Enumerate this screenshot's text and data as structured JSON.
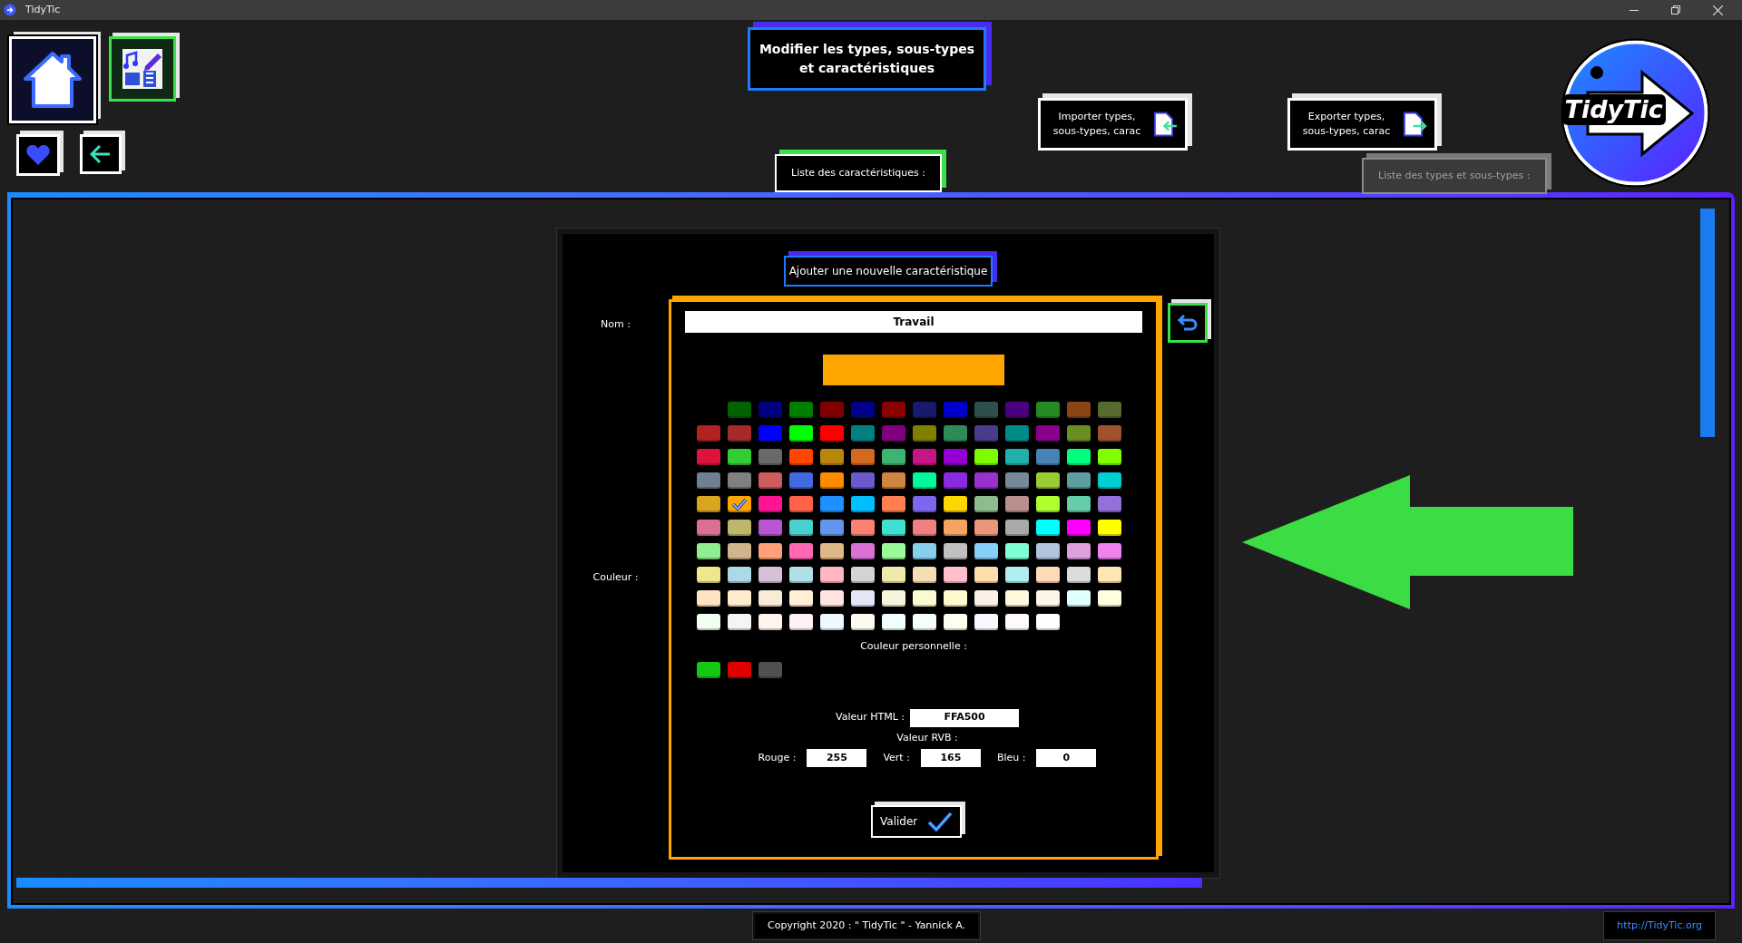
{
  "window": {
    "title": "TidyTic"
  },
  "header": {
    "title": "Modifier les types, sous-types et caractéristiques",
    "import_button": "Importer types, sous-types, carac",
    "export_button": "Exporter types, sous-types, carac",
    "logo_text": "TidyTic"
  },
  "tabs": [
    {
      "label": "Liste des caractéristiques :",
      "selected": true
    },
    {
      "label": "Liste des types et sous-types :",
      "selected": false
    }
  ],
  "form": {
    "add_button": "Ajouter une nouvelle caractéristique",
    "name_label": "Nom :",
    "name_value": "Travail",
    "color_label": "Couleur :",
    "preview": {
      "color": "#ffa500"
    },
    "palette": [
      {
        "color": "#006400",
        "selected": false
      },
      {
        "color": "#000080",
        "selected": false
      },
      {
        "color": "#008000",
        "selected": false
      },
      {
        "color": "#800000",
        "selected": false
      },
      {
        "color": "#00008b",
        "selected": false
      },
      {
        "color": "#8b0000",
        "selected": false
      },
      {
        "color": "#191970",
        "selected": false
      },
      {
        "color": "#0000cd",
        "selected": false
      },
      {
        "color": "#2f4f4f",
        "selected": false
      },
      {
        "color": "#4b0082",
        "selected": false
      },
      {
        "color": "#228b22",
        "selected": false
      },
      {
        "color": "#8b4513",
        "selected": false
      },
      {
        "color": "#556b2f",
        "selected": false
      },
      {
        "color": "#b22222",
        "selected": false
      },
      {
        "color": "#a52a2a",
        "selected": false
      },
      {
        "color": "#0000ff",
        "selected": false
      },
      {
        "color": "#00ff00",
        "selected": false
      },
      {
        "color": "#ff0000",
        "selected": false
      },
      {
        "color": "#008080",
        "selected": false
      },
      {
        "color": "#800080",
        "selected": false
      },
      {
        "color": "#808000",
        "selected": false
      },
      {
        "color": "#2e8b57",
        "selected": false
      },
      {
        "color": "#483d8b",
        "selected": false
      },
      {
        "color": "#008b8b",
        "selected": false
      },
      {
        "color": "#8b008b",
        "selected": false
      },
      {
        "color": "#6b8e23",
        "selected": false
      },
      {
        "color": "#a0522d",
        "selected": false
      },
      {
        "color": "#dc143c",
        "selected": false
      },
      {
        "color": "#32cd32",
        "selected": false
      },
      {
        "color": "#696969",
        "selected": false
      },
      {
        "color": "#ff4500",
        "selected": false
      },
      {
        "color": "#b8860b",
        "selected": false
      },
      {
        "color": "#d2691e",
        "selected": false
      },
      {
        "color": "#3cb371",
        "selected": false
      },
      {
        "color": "#c71585",
        "selected": false
      },
      {
        "color": "#9400d3",
        "selected": false
      },
      {
        "color": "#7cfc00",
        "selected": false
      },
      {
        "color": "#20b2aa",
        "selected": false
      },
      {
        "color": "#4682b4",
        "selected": false
      },
      {
        "color": "#00ff7f",
        "selected": false
      },
      {
        "color": "#7fff00",
        "selected": false
      },
      {
        "color": "#708090",
        "selected": false
      },
      {
        "color": "#808080",
        "selected": false
      },
      {
        "color": "#cd5c5c",
        "selected": false
      },
      {
        "color": "#4169e1",
        "selected": false
      },
      {
        "color": "#ff8c00",
        "selected": false
      },
      {
        "color": "#6a5acd",
        "selected": false
      },
      {
        "color": "#cd853f",
        "selected": false
      },
      {
        "color": "#00fa9a",
        "selected": false
      },
      {
        "color": "#8a2be2",
        "selected": false
      },
      {
        "color": "#9932cc",
        "selected": false
      },
      {
        "color": "#778899",
        "selected": false
      },
      {
        "color": "#9acd32",
        "selected": false
      },
      {
        "color": "#5f9ea0",
        "selected": false
      },
      {
        "color": "#00ced1",
        "selected": false
      },
      {
        "color": "#daa520",
        "selected": false
      },
      {
        "color": "#ffa500",
        "selected": true
      },
      {
        "color": "#ff1493",
        "selected": false
      },
      {
        "color": "#ff6347",
        "selected": false
      },
      {
        "color": "#1e90ff",
        "selected": false
      },
      {
        "color": "#00bfff",
        "selected": false
      },
      {
        "color": "#ff7f50",
        "selected": false
      },
      {
        "color": "#7b68ee",
        "selected": false
      },
      {
        "color": "#ffd700",
        "selected": false
      },
      {
        "color": "#8fbc8f",
        "selected": false
      },
      {
        "color": "#bc8f8f",
        "selected": false
      },
      {
        "color": "#adff2f",
        "selected": false
      },
      {
        "color": "#66cdaa",
        "selected": false
      },
      {
        "color": "#9370db",
        "selected": false
      },
      {
        "color": "#db7093",
        "selected": false
      },
      {
        "color": "#bdb76b",
        "selected": false
      },
      {
        "color": "#ba55d3",
        "selected": false
      },
      {
        "color": "#48d1cc",
        "selected": false
      },
      {
        "color": "#6495ed",
        "selected": false
      },
      {
        "color": "#fa8072",
        "selected": false
      },
      {
        "color": "#40e0d0",
        "selected": false
      },
      {
        "color": "#f08080",
        "selected": false
      },
      {
        "color": "#f4a460",
        "selected": false
      },
      {
        "color": "#e9967a",
        "selected": false
      },
      {
        "color": "#a9a9a9",
        "selected": false
      },
      {
        "color": "#00ffff",
        "selected": false
      },
      {
        "color": "#ff00ff",
        "selected": false
      },
      {
        "color": "#ffff00",
        "selected": false
      },
      {
        "color": "#90ee90",
        "selected": false
      },
      {
        "color": "#d2b48c",
        "selected": false
      },
      {
        "color": "#ffa07a",
        "selected": false
      },
      {
        "color": "#ff69b4",
        "selected": false
      },
      {
        "color": "#deb887",
        "selected": false
      },
      {
        "color": "#da70d6",
        "selected": false
      },
      {
        "color": "#98fb98",
        "selected": false
      },
      {
        "color": "#87ceeb",
        "selected": false
      },
      {
        "color": "#c0c0c0",
        "selected": false
      },
      {
        "color": "#87cefa",
        "selected": false
      },
      {
        "color": "#7fffd4",
        "selected": false
      },
      {
        "color": "#b0c4de",
        "selected": false
      },
      {
        "color": "#dda0dd",
        "selected": false
      },
      {
        "color": "#ee82ee",
        "selected": false
      },
      {
        "color": "#f0e68c",
        "selected": false
      },
      {
        "color": "#add8e6",
        "selected": false
      },
      {
        "color": "#d8bfd8",
        "selected": false
      },
      {
        "color": "#b0e0e6",
        "selected": false
      },
      {
        "color": "#ffb6c1",
        "selected": false
      },
      {
        "color": "#d3d3d3",
        "selected": false
      },
      {
        "color": "#eee8aa",
        "selected": false
      },
      {
        "color": "#f5deb3",
        "selected": false
      },
      {
        "color": "#ffc0cb",
        "selected": false
      },
      {
        "color": "#ffdead",
        "selected": false
      },
      {
        "color": "#afeeee",
        "selected": false
      },
      {
        "color": "#ffdab9",
        "selected": false
      },
      {
        "color": "#dcdcdc",
        "selected": false
      },
      {
        "color": "#ffe4b5",
        "selected": false
      },
      {
        "color": "#ffe4c4",
        "selected": false
      },
      {
        "color": "#ffebcd",
        "selected": false
      },
      {
        "color": "#faebd7",
        "selected": false
      },
      {
        "color": "#ffefd5",
        "selected": false
      },
      {
        "color": "#ffe4e1",
        "selected": false
      },
      {
        "color": "#e6e6fa",
        "selected": false
      },
      {
        "color": "#f5f5dc",
        "selected": false
      },
      {
        "color": "#fafad2",
        "selected": false
      },
      {
        "color": "#fffacd",
        "selected": false
      },
      {
        "color": "#faf0e6",
        "selected": false
      },
      {
        "color": "#fff8dc",
        "selected": false
      },
      {
        "color": "#fdf5e6",
        "selected": false
      },
      {
        "color": "#e0ffff",
        "selected": false
      },
      {
        "color": "#ffffe0",
        "selected": false
      },
      {
        "color": "#f0fff0",
        "selected": false
      },
      {
        "color": "#f5f5f5",
        "selected": false
      },
      {
        "color": "#fff5ee",
        "selected": false
      },
      {
        "color": "#fff0f5",
        "selected": false
      },
      {
        "color": "#f0f8ff",
        "selected": false
      },
      {
        "color": "#fffaf0",
        "selected": false
      },
      {
        "color": "#f0ffff",
        "selected": false
      },
      {
        "color": "#f5fffa",
        "selected": false
      },
      {
        "color": "#fffff0",
        "selected": false
      },
      {
        "color": "#f8f8ff",
        "selected": false
      },
      {
        "color": "#fffafa",
        "selected": false
      },
      {
        "color": "#ffffff",
        "selected": false
      }
    ],
    "custom_label": "Couleur personnelle :",
    "custom_colors": [
      {
        "color": "#14c814"
      },
      {
        "color": "#e00000"
      },
      {
        "color": "#505050"
      }
    ],
    "html_label": "Valeur HTML :",
    "html_value": "FFA500",
    "rgb_label": "Valeur RVB :",
    "red_label": "Rouge :",
    "red_value": "255",
    "green_label": "Vert :",
    "green_value": "165",
    "blue_label": "Bleu :",
    "blue_value": "0",
    "submit_button": "Valider"
  },
  "footer": {
    "copyright": "Copyright 2020 : \" TidyTic \" - Yannick A.",
    "link": "http://TidyTic.org"
  }
}
